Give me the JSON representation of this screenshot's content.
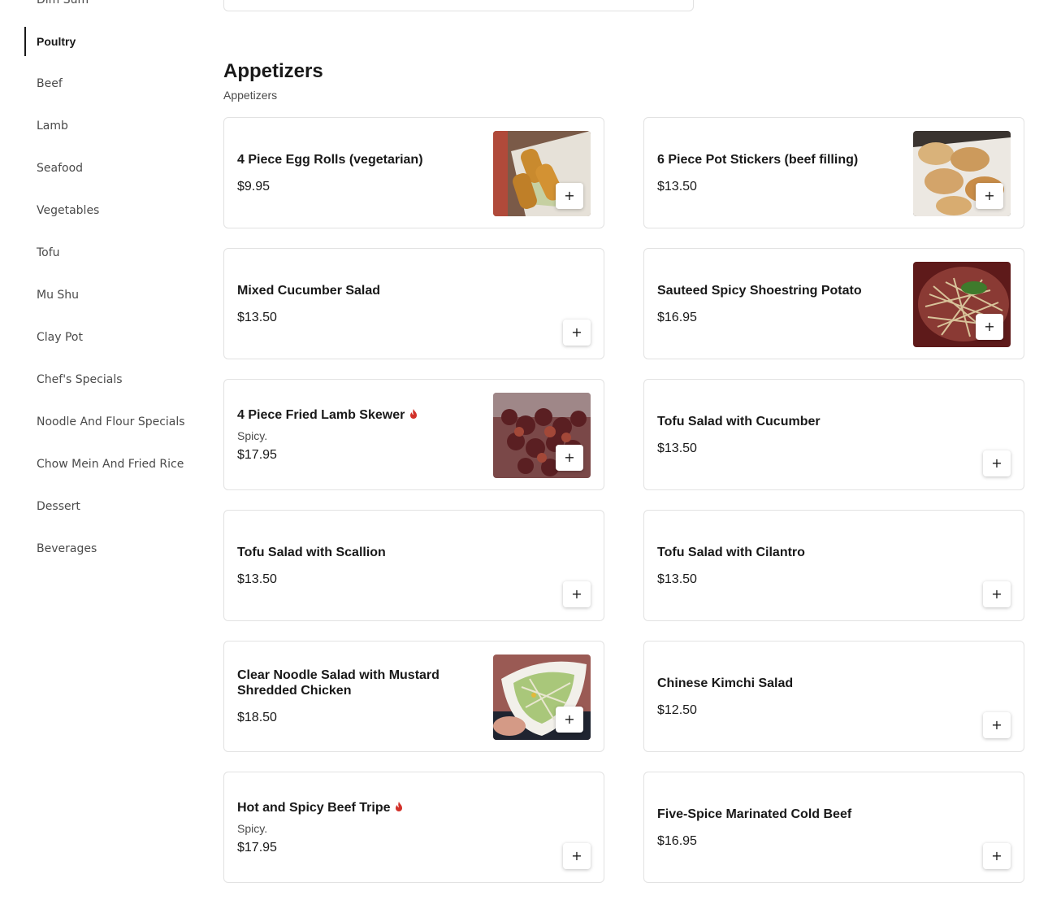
{
  "sidebar": {
    "items": [
      {
        "label": "Dim Sum"
      },
      {
        "label": "Poultry"
      },
      {
        "label": "Beef"
      },
      {
        "label": "Lamb"
      },
      {
        "label": "Seafood"
      },
      {
        "label": "Vegetables"
      },
      {
        "label": "Tofu"
      },
      {
        "label": "Mu Shu"
      },
      {
        "label": "Clay Pot"
      },
      {
        "label": "Chef's Specials"
      },
      {
        "label": "Noodle And Flour Specials"
      },
      {
        "label": "Chow Mein And Fried Rice"
      },
      {
        "label": "Dessert"
      },
      {
        "label": "Beverages"
      }
    ],
    "active": "Poultry"
  },
  "section": {
    "title": "Appetizers",
    "subtitle": "Appetizers"
  },
  "items": [
    {
      "name": "4 Piece Egg Rolls (vegetarian)",
      "price": "$9.95",
      "image": "egg-rolls-photo"
    },
    {
      "name": "6 Piece Pot Stickers (beef filling)",
      "price": "$13.50",
      "image": "pot-stickers-photo"
    },
    {
      "name": "Mixed Cucumber Salad",
      "price": "$13.50"
    },
    {
      "name": "Sauteed Spicy Shoestring Potato",
      "price": "$16.95",
      "image": "shoestring-potato-photo"
    },
    {
      "name": "4 Piece Fried Lamb Skewer",
      "desc": "Spicy.",
      "price": "$17.95",
      "spicy": true,
      "image": "lamb-skewer-photo"
    },
    {
      "name": "Tofu Salad with Cucumber",
      "price": "$13.50"
    },
    {
      "name": "Tofu Salad with Scallion",
      "price": "$13.50"
    },
    {
      "name": "Tofu Salad with Cilantro",
      "price": "$13.50"
    },
    {
      "name": "Clear Noodle Salad with Mustard Shredded Chicken",
      "price": "$18.50",
      "image": "noodle-salad-photo"
    },
    {
      "name": "Chinese Kimchi Salad",
      "price": "$12.50"
    },
    {
      "name": "Hot and Spicy Beef Tripe",
      "desc": "Spicy.",
      "price": "$17.95",
      "spicy": true
    },
    {
      "name": "Five-Spice Marinated Cold Beef",
      "price": "$16.95"
    }
  ],
  "add_button": {
    "icon": "plus-icon",
    "glyph": "+"
  },
  "colors": {
    "text": "#191919",
    "secondary": "#4a4a4a",
    "border": "#e2e2e2",
    "spicy": "#d2312a"
  }
}
